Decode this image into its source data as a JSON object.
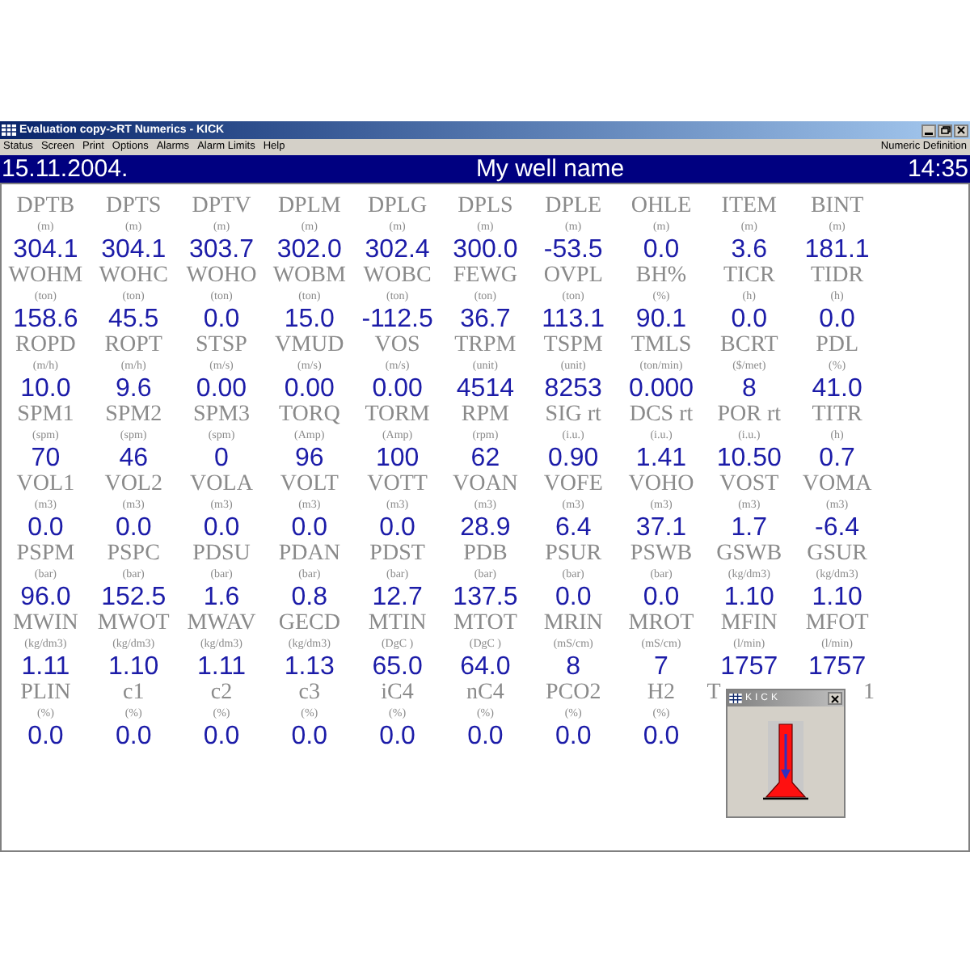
{
  "window": {
    "title": "Evaluation copy->RT Numerics - KICK"
  },
  "menu": [
    "Status",
    "Screen",
    "Print",
    "Options",
    "Alarms",
    "Alarm Limits",
    "Help"
  ],
  "menu_right": "Numeric Definition",
  "header": {
    "date": "15.11.2004.",
    "title": "My well name",
    "time": "14:35"
  },
  "rows": [
    [
      {
        "label": "DPTB",
        "unit": "(m)",
        "value": "304.1"
      },
      {
        "label": "DPTS",
        "unit": "(m)",
        "value": "304.1"
      },
      {
        "label": "DPTV",
        "unit": "(m)",
        "value": "303.7"
      },
      {
        "label": "DPLM",
        "unit": "(m)",
        "value": "302.0"
      },
      {
        "label": "DPLG",
        "unit": "(m)",
        "value": "302.4"
      },
      {
        "label": "DPLS",
        "unit": "(m)",
        "value": "300.0"
      },
      {
        "label": "DPLE",
        "unit": "(m)",
        "value": "-53.5"
      },
      {
        "label": "OHLE",
        "unit": "(m)",
        "value": "0.0"
      },
      {
        "label": "ITEM",
        "unit": "(m)",
        "value": "3.6"
      },
      {
        "label": "BINT",
        "unit": "(m)",
        "value": "181.1"
      }
    ],
    [
      {
        "label": "WOHM",
        "unit": "(ton)",
        "value": "158.6"
      },
      {
        "label": "WOHC",
        "unit": "(ton)",
        "value": "45.5"
      },
      {
        "label": "WOHO",
        "unit": "(ton)",
        "value": "0.0"
      },
      {
        "label": "WOBM",
        "unit": "(ton)",
        "value": "15.0"
      },
      {
        "label": "WOBC",
        "unit": "(ton)",
        "value": "-112.5"
      },
      {
        "label": "FEWG",
        "unit": "(ton)",
        "value": "36.7"
      },
      {
        "label": "OVPL",
        "unit": "(ton)",
        "value": "113.1"
      },
      {
        "label": "BH%",
        "unit": "(%)",
        "value": "90.1"
      },
      {
        "label": "TICR",
        "unit": "(h)",
        "value": "0.0"
      },
      {
        "label": "TIDR",
        "unit": "(h)",
        "value": "0.0"
      }
    ],
    [
      {
        "label": "ROPD",
        "unit": "(m/h)",
        "value": "10.0"
      },
      {
        "label": "ROPT",
        "unit": "(m/h)",
        "value": "9.6"
      },
      {
        "label": "STSP",
        "unit": "(m/s)",
        "value": "0.00"
      },
      {
        "label": "VMUD",
        "unit": "(m/s)",
        "value": "0.00"
      },
      {
        "label": "VOS",
        "unit": "(m/s)",
        "value": "0.00"
      },
      {
        "label": "TRPM",
        "unit": "(unit)",
        "value": "4514"
      },
      {
        "label": "TSPM",
        "unit": "(unit)",
        "value": "8253"
      },
      {
        "label": "TMLS",
        "unit": "(ton/min)",
        "value": "0.000"
      },
      {
        "label": "BCRT",
        "unit": "($/met)",
        "value": "8"
      },
      {
        "label": "PDL",
        "unit": "(%)",
        "value": "41.0"
      }
    ],
    [
      {
        "label": "SPM1",
        "unit": "(spm)",
        "value": "70"
      },
      {
        "label": "SPM2",
        "unit": "(spm)",
        "value": "46"
      },
      {
        "label": "SPM3",
        "unit": "(spm)",
        "value": "0"
      },
      {
        "label": "TORQ",
        "unit": "(Amp)",
        "value": "96"
      },
      {
        "label": "TORM",
        "unit": "(Amp)",
        "value": "100"
      },
      {
        "label": "RPM",
        "unit": "(rpm)",
        "value": "62"
      },
      {
        "label": "SIG rt",
        "unit": "(i.u.)",
        "value": "0.90"
      },
      {
        "label": "DCS rt",
        "unit": "(i.u.)",
        "value": "1.41"
      },
      {
        "label": "POR rt",
        "unit": "(i.u.)",
        "value": "10.50"
      },
      {
        "label": "TITR",
        "unit": "(h)",
        "value": "0.7"
      }
    ],
    [
      {
        "label": "VOL1",
        "unit": "(m3)",
        "value": "0.0"
      },
      {
        "label": "VOL2",
        "unit": "(m3)",
        "value": "0.0"
      },
      {
        "label": "VOLA",
        "unit": "(m3)",
        "value": "0.0"
      },
      {
        "label": "VOLT",
        "unit": "(m3)",
        "value": "0.0"
      },
      {
        "label": "VOTT",
        "unit": "(m3)",
        "value": "0.0"
      },
      {
        "label": "VOAN",
        "unit": "(m3)",
        "value": "28.9"
      },
      {
        "label": "VOFE",
        "unit": "(m3)",
        "value": "6.4"
      },
      {
        "label": "VOHO",
        "unit": "(m3)",
        "value": "37.1"
      },
      {
        "label": "VOST",
        "unit": "(m3)",
        "value": "1.7"
      },
      {
        "label": "VOMA",
        "unit": "(m3)",
        "value": "-6.4"
      }
    ],
    [
      {
        "label": "PSPM",
        "unit": "(bar)",
        "value": "96.0"
      },
      {
        "label": "PSPC",
        "unit": "(bar)",
        "value": "152.5"
      },
      {
        "label": "PDSU",
        "unit": "(bar)",
        "value": "1.6"
      },
      {
        "label": "PDAN",
        "unit": "(bar)",
        "value": "0.8"
      },
      {
        "label": "PDST",
        "unit": "(bar)",
        "value": "12.7"
      },
      {
        "label": "PDB",
        "unit": "(bar)",
        "value": "137.5"
      },
      {
        "label": "PSUR",
        "unit": "(bar)",
        "value": "0.0"
      },
      {
        "label": "PSWB",
        "unit": "(bar)",
        "value": "0.0"
      },
      {
        "label": "GSWB",
        "unit": "(kg/dm3)",
        "value": "1.10"
      },
      {
        "label": "GSUR",
        "unit": "(kg/dm3)",
        "value": "1.10"
      }
    ],
    [
      {
        "label": "MWIN",
        "unit": "(kg/dm3)",
        "value": "1.11"
      },
      {
        "label": "MWOT",
        "unit": "(kg/dm3)",
        "value": "1.10"
      },
      {
        "label": "MWAV",
        "unit": "(kg/dm3)",
        "value": "1.11"
      },
      {
        "label": "GECD",
        "unit": "(kg/dm3)",
        "value": "1.13"
      },
      {
        "label": "MTIN",
        "unit": "(DgC )",
        "value": "65.0"
      },
      {
        "label": "MTOT",
        "unit": "(DgC )",
        "value": "64.0"
      },
      {
        "label": "MRIN",
        "unit": "(mS/cm)",
        "value": "8"
      },
      {
        "label": "MROT",
        "unit": "(mS/cm)",
        "value": "7"
      },
      {
        "label": "MFIN",
        "unit": "(l/min)",
        "value": "1757"
      },
      {
        "label": "MFOT",
        "unit": "(l/min)",
        "value": "1757"
      }
    ],
    [
      {
        "label": "PLIN",
        "unit": "(%)",
        "value": "0.0"
      },
      {
        "label": "c1",
        "unit": "(%)",
        "value": "0.0"
      },
      {
        "label": "c2",
        "unit": "(%)",
        "value": "0.0"
      },
      {
        "label": "c3",
        "unit": "(%)",
        "value": "0.0"
      },
      {
        "label": "iC4",
        "unit": "(%)",
        "value": "0.0"
      },
      {
        "label": "nC4",
        "unit": "(%)",
        "value": "0.0"
      },
      {
        "label": "PCO2",
        "unit": "(%)",
        "value": "0.0"
      },
      {
        "label": "H2",
        "unit": "(%)",
        "value": "0.0"
      },
      {
        "label": "T",
        "kind": "partial_left"
      },
      {
        "label": "1",
        "kind": "partial_right"
      }
    ]
  ],
  "kick_window": {
    "title": "KICK"
  }
}
